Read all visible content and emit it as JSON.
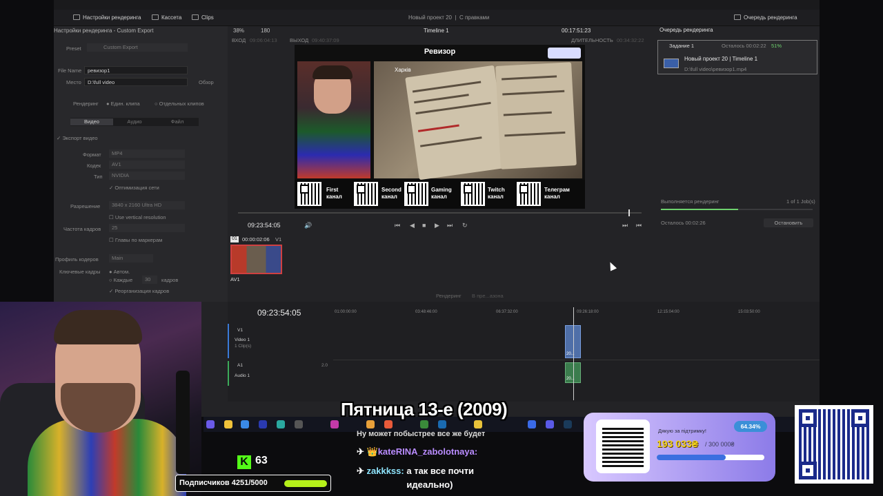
{
  "toolbar": {
    "render_settings": "Настройки рендеринга",
    "media": "Кассета",
    "clips": "Clips",
    "project_title": "Новый проект 20",
    "project_state": "С правками",
    "render_queue": "Очередь рендеринга"
  },
  "render_settings": {
    "title": "Настройки рендеринга - Custom Export",
    "preset_label": "Preset",
    "preset_value": "Custom Export",
    "filename_label": "File Name",
    "filename_value": "ревизор1",
    "location_label": "Место",
    "location_value": "D:\\full video",
    "browse": "Обзор",
    "render_label": "Рендеринг",
    "render_single": "Един. клипа",
    "render_multi": "Отдельных клипов",
    "tabs": [
      "Видео",
      "Аудио",
      "Файл"
    ],
    "export_video": "Экспорт видео",
    "format_label": "Формат",
    "format_value": "MP4",
    "codec_label": "Кодек",
    "codec_value": "AV1",
    "type_label": "Тип",
    "type_value": "NVIDIA",
    "network_opt": "Оптимизация сети",
    "resolution_label": "Разрешение",
    "resolution_value": "3840 x 2160 Ultra HD",
    "vertical_res": "Use vertical resolution",
    "fps_label": "Частота кадров",
    "fps_value": "25",
    "chapters": "Главы по маркерам",
    "profile_label": "Профиль кодеров",
    "profile_value": "Main",
    "keyframes_label": "Ключевые кадры",
    "keyframes_auto": "Автом.",
    "keyframes_every": "Каждые",
    "keyframes_num": "30",
    "keyframes_unit": "кадров",
    "reorder": "Реорганизация кадров"
  },
  "viewer": {
    "zoom": "38%",
    "frames": "180",
    "timeline_name": "Timeline 1",
    "timecode_top": "00:17:51:23",
    "in_label": "ВХОД",
    "in_value": "09:06:04:13",
    "out_label": "ВЫХОД",
    "out_value": "09:40:37:09",
    "duration_label": "ДЛИТЕЛЬНОСТЬ",
    "duration_value": "00:34:32:22",
    "current_tc": "09:23:54:05",
    "video_title": "Ревизор",
    "city": "Харків",
    "qr_labels": [
      "First канал",
      "Second канал",
      "Gaming канал",
      "Twitch канал",
      "Телеграм канал"
    ]
  },
  "render_queue": {
    "job_title": "Задание 1",
    "job_remaining": "Осталось 00:02:22",
    "job_pct": "51%",
    "job_name": "Новый проект 20 | Timeline 1",
    "job_path": "D:\\full video\\ревизор1.mp4",
    "status": "Выполняется рендеринг",
    "jobs_count": "1 of 1 Job(s)",
    "remaining": "Осталось 00:02:26",
    "stop_btn": "Остановить"
  },
  "clip_bin": {
    "index": "01",
    "clip_tc": "00:00:02:06",
    "track": "V1",
    "codec": "AV1"
  },
  "timeline": {
    "render_label": "Рендеринг",
    "render_mode": "В пре...азона",
    "tc": "09:23:54:05",
    "ruler": [
      "01:00:00:00",
      "03:48:46:00",
      "06:37:32:00",
      "09:26:18:00",
      "12:15:04:00",
      "15:03:50:00"
    ],
    "v1": "V1",
    "video1": "Video 1",
    "video1_clips": "1 Clip(s)",
    "a1": "A1",
    "audio1": "Audio 1",
    "a1_level": "2.0",
    "clip_label": "20..."
  },
  "overlay": {
    "kick_count": "63",
    "kick_letter": "K",
    "subs_text": "Подписчиков 4251/5000",
    "film_title": "Пятница 13-е (2009)",
    "chat_prev": "Ну может побыстрее все же будет",
    "chat_user1": "kateRINA_zabolotnaya:",
    "chat_user2": "zakkkss:",
    "chat_msg2": "а так все почти идеально)",
    "donate_text": "Дякую за підтримку!",
    "donate_amount": "193 033₴",
    "donate_goal": "/ 300 000₴",
    "donate_pct": "64.34%",
    "donate_fraction": 0.6434
  }
}
